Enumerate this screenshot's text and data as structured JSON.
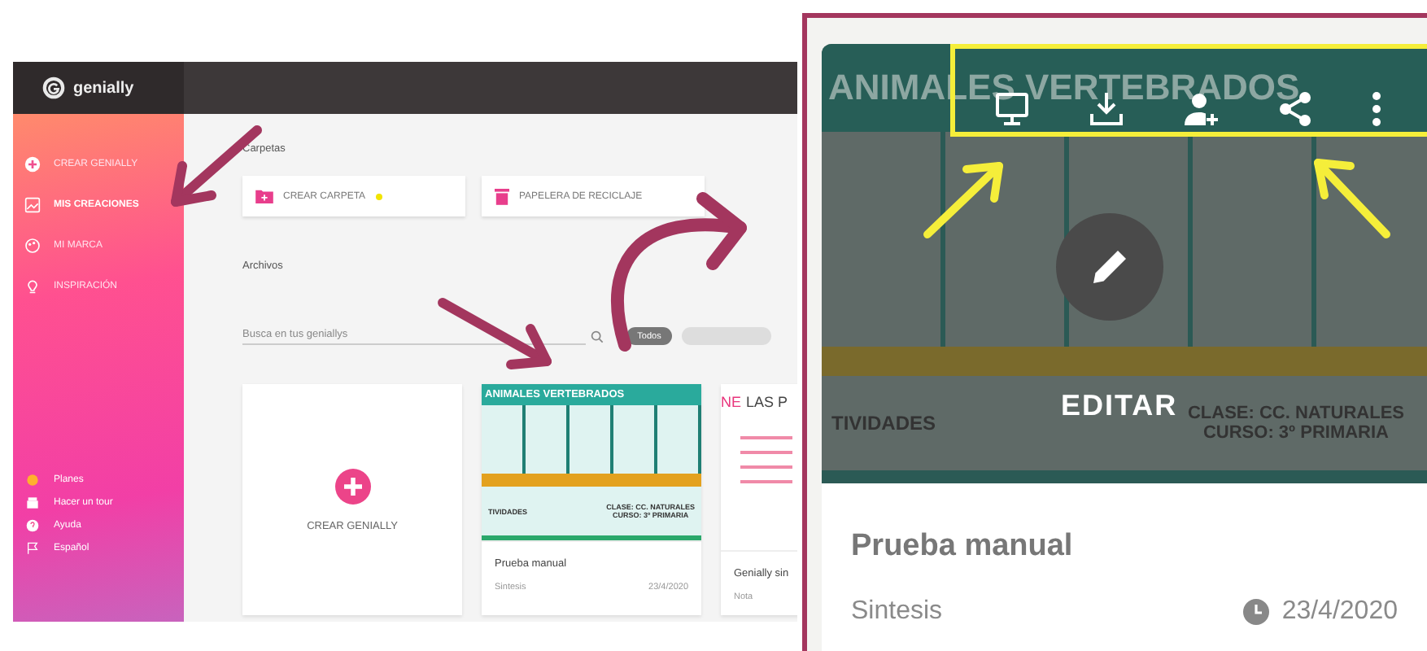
{
  "logo": {
    "text": "genially"
  },
  "sidebar": {
    "items": [
      {
        "label": "CREAR GENIALLY",
        "selected": false
      },
      {
        "label": "MIS CREACIONES",
        "selected": true
      },
      {
        "label": "MI MARCA",
        "selected": false
      },
      {
        "label": "INSPIRACIÓN",
        "selected": false
      }
    ],
    "footer_items": [
      {
        "label": "Planes"
      },
      {
        "label": "Hacer un tour"
      },
      {
        "label": "Ayuda"
      },
      {
        "label": "Español"
      }
    ]
  },
  "folders": {
    "heading": "Carpetas",
    "buttons": [
      {
        "label": "CREAR CARPETA",
        "kind": "create"
      },
      {
        "label": "PAPELERA DE RECICLAJE",
        "kind": "trash"
      }
    ]
  },
  "files": {
    "heading": "Archivos",
    "search": {
      "placeholder": "Busca en tus geniallys"
    },
    "filters": [
      {
        "label": "Todos",
        "selected": true
      },
      {
        "selected": false
      }
    ]
  },
  "cards": [
    {
      "kind": "create",
      "label": "CREAR GENIALLY"
    },
    {
      "kind": "vertebrados",
      "thumb_title": "ANIMALES VERTEBRADOS",
      "thumb_left": "TIVIDADES",
      "thumb_right": [
        "CLASE: CC. NATURALES",
        "CURSO: 3º PRIMARIA"
      ],
      "title": "Prueba manual",
      "type": "Sintesis",
      "date": "23/4/2020"
    },
    {
      "kind": "list",
      "thumb_accent": "NE",
      "thumb_title": "LAS P",
      "title": "Genially sin",
      "type": "Nota"
    }
  ],
  "zoom_panel": {
    "thumb_title": "ANIMALES VERTEBRADOS",
    "thumb_left": "TIVIDADES",
    "thumb_right": [
      "CLASE: CC. NATURALES",
      "CURSO: 3º PRIMARIA"
    ],
    "edit_label": "EDITAR",
    "title": "Prueba manual",
    "type": "Sintesis",
    "date": "23/4/2020"
  }
}
